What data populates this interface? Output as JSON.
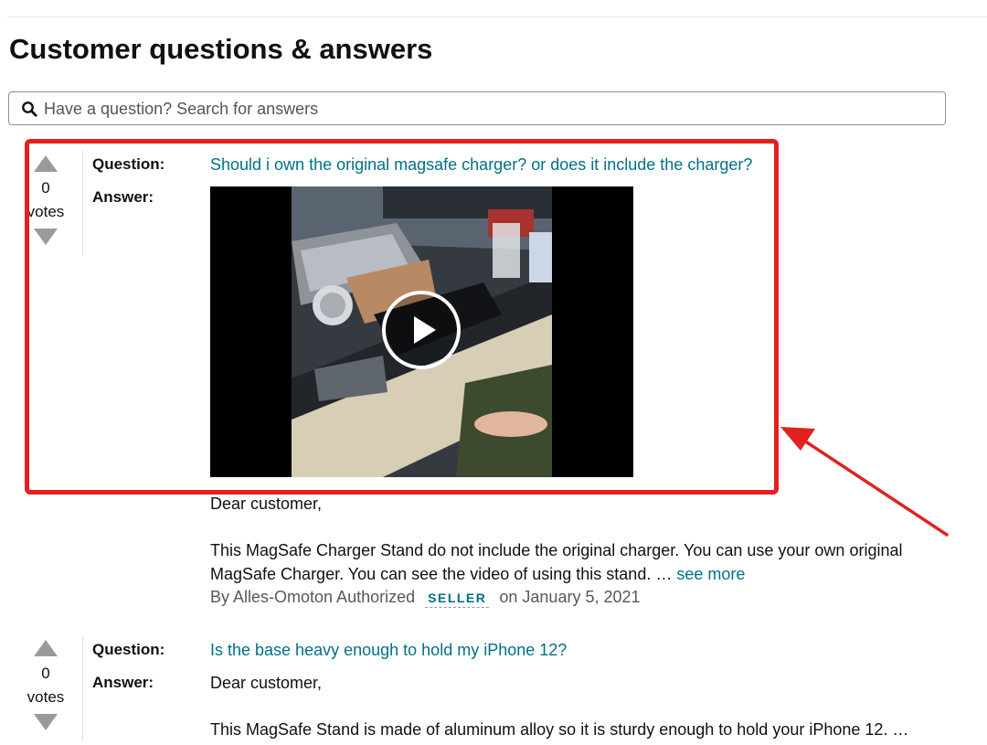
{
  "page_title": "Customer questions & answers",
  "search": {
    "placeholder": "Have a question? Search for answers"
  },
  "labels": {
    "question": "Question:",
    "answer": "Answer:"
  },
  "questions": [
    {
      "votes": "0",
      "votes_label": "votes",
      "question": "Should i own the original magsafe charger? or does it include the charger?",
      "answer_greeting": "Dear customer,",
      "answer_line1": "This MagSafe Charger Stand do not include the original charger. You can use your own original",
      "answer_line2": "MagSafe Charger. You can see the video of using this stand. …",
      "see_more": "see more",
      "by": "By Alles-Omoton Authorized",
      "seller_badge": "SELLER",
      "date": "on January 5, 2021"
    },
    {
      "votes": "0",
      "votes_label": "votes",
      "question": "Is the base heavy enough to hold my iPhone 12?",
      "answer_greeting": "Dear customer,",
      "answer_line1": "This MagSafe Stand is made of aluminum alloy so it is sturdy enough to hold your iPhone 12. …"
    }
  ],
  "colors": {
    "link": "#007185",
    "highlight": "#e0211f",
    "meta": "#565959"
  },
  "icons": [
    "search-icon",
    "vote-up-icon",
    "vote-down-icon",
    "play-icon",
    "arrow-annotation"
  ]
}
